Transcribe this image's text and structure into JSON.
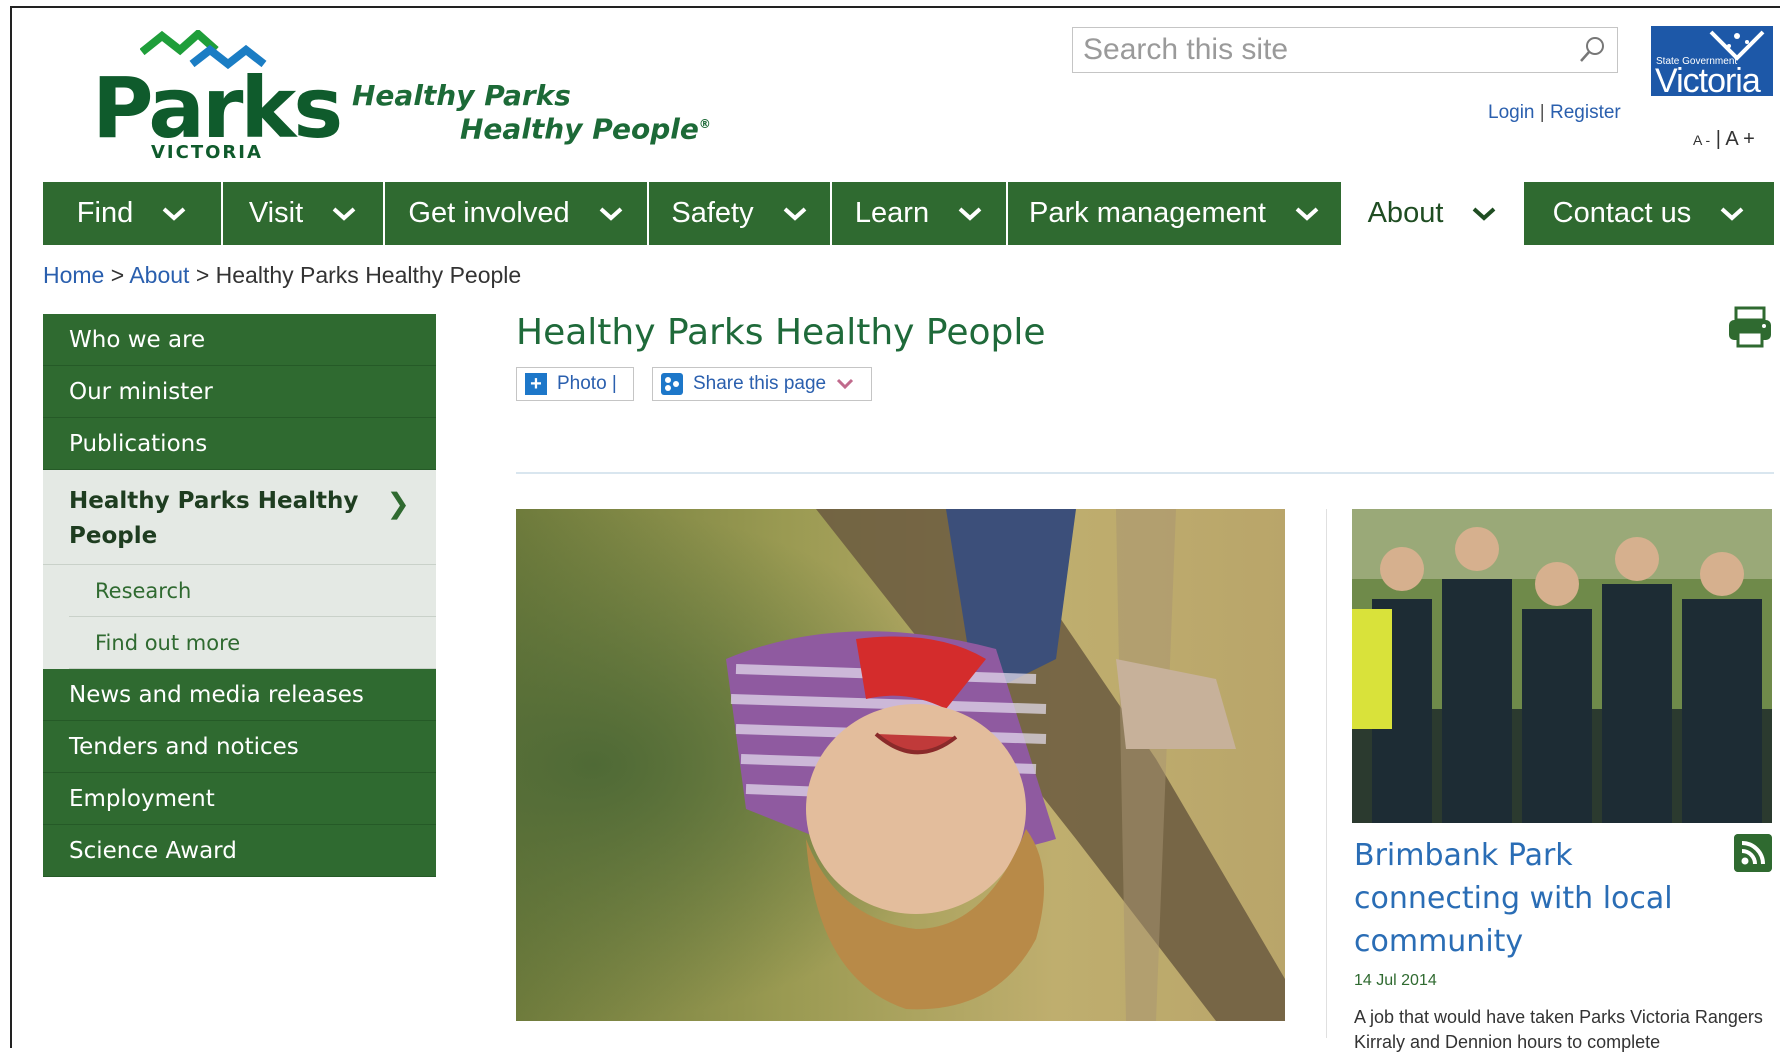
{
  "header": {
    "logo_word": "Parks",
    "logo_sub": "VICTORIA",
    "tagline_line1": "Healthy Parks",
    "tagline_line2": "Healthy People",
    "tagline_mark": "®",
    "search_placeholder": "Search this site",
    "login": "Login",
    "separator": "|",
    "register": "Register",
    "gov_small": "State Government",
    "gov_name": "Victoria",
    "font_decrease": "A -",
    "font_increase": "A +"
  },
  "nav": {
    "items": [
      {
        "label": "Find",
        "width": 180
      },
      {
        "label": "Visit",
        "width": 162
      },
      {
        "label": "Get involved",
        "width": 264
      },
      {
        "label": "Safety",
        "width": 183
      },
      {
        "label": "Learn",
        "width": 176
      },
      {
        "label": "Park management",
        "width": 335
      },
      {
        "label": "About",
        "width": 181,
        "active": true
      },
      {
        "label": "Contact us",
        "width": 250
      }
    ]
  },
  "breadcrumb": {
    "home": "Home",
    "sep": ">",
    "about": "About",
    "current": "Healthy Parks Healthy People"
  },
  "sidebar": {
    "before": [
      "Who we are",
      "Our minister",
      "Publications"
    ],
    "current": "Healthy Parks Healthy People",
    "current_arrow": "❯",
    "subitems": [
      "Research",
      "Find out more"
    ],
    "after": [
      "News and media releases",
      "Tenders and notices",
      "Employment",
      "Science Award"
    ]
  },
  "main": {
    "title": "Healthy Parks Healthy People",
    "photo_btn": "Photo |",
    "share_btn": "Share this page",
    "share_chevron": "❯"
  },
  "news": {
    "title": "Brimbank Park connecting with local community",
    "date": "14 Jul 2014",
    "text": "A job that would have taken Parks Victoria Rangers Kirraly and Dennion hours to complete"
  },
  "colors": {
    "brand_green": "#2f6a30",
    "link_blue": "#2a5fae",
    "title_green": "#1f6a3a"
  }
}
